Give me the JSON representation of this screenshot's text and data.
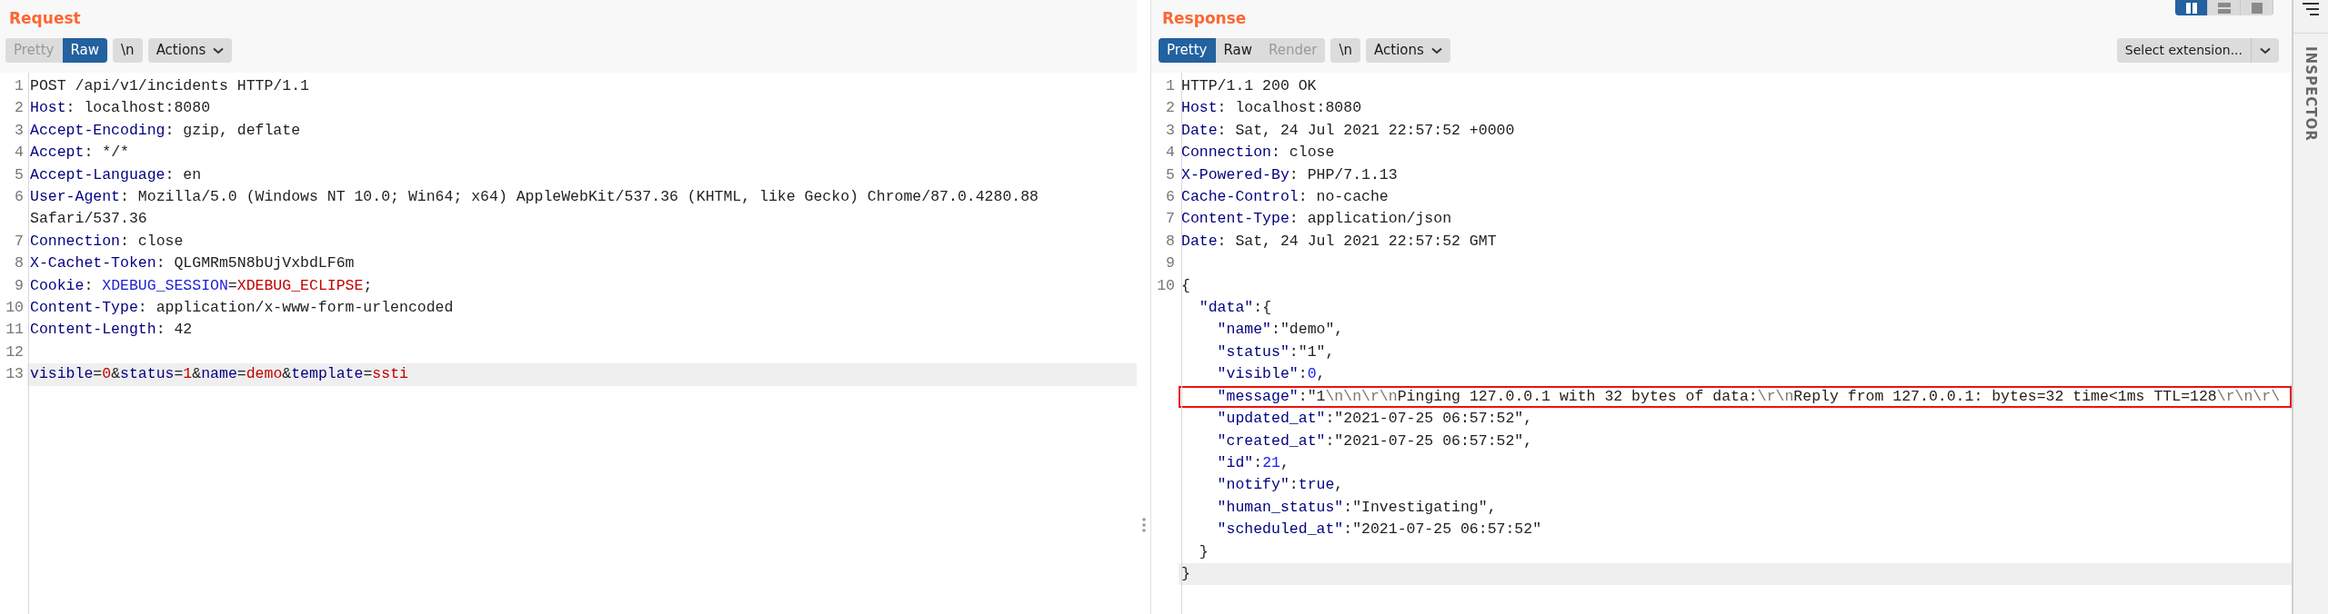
{
  "layout_buttons": [
    {
      "kind": "columns",
      "selected": true
    },
    {
      "kind": "rows",
      "selected": false
    },
    {
      "kind": "single",
      "selected": false
    }
  ],
  "request": {
    "title": "Request",
    "view_tabs": [
      {
        "label": "Pretty",
        "selected": false,
        "disabled": true
      },
      {
        "label": "Raw",
        "selected": true,
        "disabled": false
      }
    ],
    "newline_button": "\\n",
    "actions_button": "Actions",
    "lines": [
      {
        "number": "1",
        "tokens": [
          {
            "kind": "plain",
            "text": "POST /api/v1/incidents HTTP/1.1"
          }
        ]
      },
      {
        "number": "2",
        "tokens": [
          {
            "kind": "key",
            "text": "Host"
          },
          {
            "kind": "plain",
            "text": ": localhost:8080"
          }
        ]
      },
      {
        "number": "3",
        "tokens": [
          {
            "kind": "key",
            "text": "Accept-Encoding"
          },
          {
            "kind": "plain",
            "text": ": gzip, deflate"
          }
        ]
      },
      {
        "number": "4",
        "tokens": [
          {
            "kind": "key",
            "text": "Accept"
          },
          {
            "kind": "plain",
            "text": ": */*"
          }
        ]
      },
      {
        "number": "5",
        "tokens": [
          {
            "kind": "key",
            "text": "Accept-Language"
          },
          {
            "kind": "plain",
            "text": ": en"
          }
        ]
      },
      {
        "number": "6",
        "tokens": [
          {
            "kind": "key",
            "text": "User-Agent"
          },
          {
            "kind": "plain",
            "text": ": Mozilla/5.0 (Windows NT 10.0; Win64; x64) AppleWebKit/537.36 (KHTML, like Gecko) Chrome/87.0.4280.88 Safari/537.36"
          }
        ]
      },
      {
        "number": "7",
        "tokens": [
          {
            "kind": "key",
            "text": "Connection"
          },
          {
            "kind": "plain",
            "text": ": close"
          }
        ]
      },
      {
        "number": "8",
        "tokens": [
          {
            "kind": "key",
            "text": "X-Cachet-Token"
          },
          {
            "kind": "plain",
            "text": ": QLGMRm5N8bUjVxbdLF6m"
          }
        ]
      },
      {
        "number": "9",
        "tokens": [
          {
            "kind": "key",
            "text": "Cookie"
          },
          {
            "kind": "plain",
            "text": ": "
          },
          {
            "kind": "name",
            "text": "XDEBUG_SESSION"
          },
          {
            "kind": "plain",
            "text": "="
          },
          {
            "kind": "value",
            "text": "XDEBUG_ECLIPSE"
          },
          {
            "kind": "plain",
            "text": ";"
          }
        ]
      },
      {
        "number": "10",
        "tokens": [
          {
            "kind": "key",
            "text": "Content-Type"
          },
          {
            "kind": "plain",
            "text": ": application/x-www-form-urlencoded"
          }
        ]
      },
      {
        "number": "11",
        "tokens": [
          {
            "kind": "key",
            "text": "Content-Length"
          },
          {
            "kind": "plain",
            "text": ": 42"
          }
        ]
      },
      {
        "number": "12"
      },
      {
        "number": "13",
        "current": true,
        "tokens": [
          {
            "kind": "key",
            "text": "visible"
          },
          {
            "kind": "plain",
            "text": "="
          },
          {
            "kind": "value",
            "text": "0"
          },
          {
            "kind": "plain",
            "text": "&"
          },
          {
            "kind": "key",
            "text": "status"
          },
          {
            "kind": "plain",
            "text": "="
          },
          {
            "kind": "value",
            "text": "1"
          },
          {
            "kind": "plain",
            "text": "&"
          },
          {
            "kind": "key",
            "text": "name"
          },
          {
            "kind": "plain",
            "text": "="
          },
          {
            "kind": "value",
            "text": "demo"
          },
          {
            "kind": "plain",
            "text": "&"
          },
          {
            "kind": "key",
            "text": "template"
          },
          {
            "kind": "plain",
            "text": "="
          },
          {
            "kind": "value",
            "text": "ssti"
          }
        ]
      }
    ]
  },
  "response": {
    "title": "Response",
    "view_tabs": [
      {
        "label": "Pretty",
        "selected": true,
        "disabled": false
      },
      {
        "label": "Raw",
        "selected": false,
        "disabled": false
      },
      {
        "label": "Render",
        "selected": false,
        "disabled": true
      }
    ],
    "newline_button": "\\n",
    "actions_button": "Actions",
    "extension_select": "Select extension...",
    "lines": [
      {
        "number": "1",
        "tokens": [
          {
            "kind": "plain",
            "text": "HTTP/1.1 200 OK"
          }
        ]
      },
      {
        "number": "2",
        "tokens": [
          {
            "kind": "key",
            "text": "Host"
          },
          {
            "kind": "plain",
            "text": ": localhost:8080"
          }
        ]
      },
      {
        "number": "3",
        "tokens": [
          {
            "kind": "key",
            "text": "Date"
          },
          {
            "kind": "plain",
            "text": ": Sat, 24 Jul 2021 22:57:52 +0000"
          }
        ]
      },
      {
        "number": "4",
        "tokens": [
          {
            "kind": "key",
            "text": "Connection"
          },
          {
            "kind": "plain",
            "text": ": close"
          }
        ]
      },
      {
        "number": "5",
        "tokens": [
          {
            "kind": "key",
            "text": "X-Powered-By"
          },
          {
            "kind": "plain",
            "text": ": PHP/7.1.13"
          }
        ]
      },
      {
        "number": "6",
        "tokens": [
          {
            "kind": "key",
            "text": "Cache-Control"
          },
          {
            "kind": "plain",
            "text": ": no-cache"
          }
        ]
      },
      {
        "number": "7",
        "tokens": [
          {
            "kind": "key",
            "text": "Content-Type"
          },
          {
            "kind": "plain",
            "text": ": application/json"
          }
        ]
      },
      {
        "number": "8",
        "tokens": [
          {
            "kind": "key",
            "text": "Date"
          },
          {
            "kind": "plain",
            "text": ": Sat, 24 Jul 2021 22:57:52 GMT"
          }
        ]
      },
      {
        "number": "9"
      },
      {
        "number": "10",
        "tokens": [
          {
            "kind": "plain",
            "text": "{"
          }
        ]
      },
      {
        "tokens": [
          {
            "kind": "key",
            "text": "  \"data\""
          },
          {
            "kind": "plain",
            "text": ":{"
          }
        ]
      },
      {
        "tokens": [
          {
            "kind": "key",
            "text": "    \"name\""
          },
          {
            "kind": "plain",
            "text": ":\"demo\","
          }
        ]
      },
      {
        "tokens": [
          {
            "kind": "key",
            "text": "    \"status\""
          },
          {
            "kind": "plain",
            "text": ":\"1\","
          }
        ]
      },
      {
        "tokens": [
          {
            "kind": "key",
            "text": "    \"visible\""
          },
          {
            "kind": "plain",
            "text": ":"
          },
          {
            "kind": "number",
            "text": "0"
          },
          {
            "kind": "plain",
            "text": ","
          }
        ]
      },
      {
        "boxed": true,
        "tokens": [
          {
            "kind": "key",
            "text": "    \"message\""
          },
          {
            "kind": "plain",
            "text": ":\"1"
          },
          {
            "kind": "escape",
            "text": "\\n\\n\\r\\n"
          },
          {
            "kind": "plain",
            "text": "Pinging 127.0.0.1 with 32 bytes of data:"
          },
          {
            "kind": "escape",
            "text": "\\r\\n"
          },
          {
            "kind": "plain",
            "text": "Reply from 127.0.0.1: bytes=32 time<1ms TTL=128"
          },
          {
            "kind": "escape",
            "text": "\\r\\n\\r\\"
          }
        ]
      },
      {
        "tokens": [
          {
            "kind": "key",
            "text": "    \"updated_at\""
          },
          {
            "kind": "plain",
            "text": ":\"2021-07-25 06:57:52\","
          }
        ]
      },
      {
        "tokens": [
          {
            "kind": "key",
            "text": "    \"created_at\""
          },
          {
            "kind": "plain",
            "text": ":\"2021-07-25 06:57:52\","
          }
        ]
      },
      {
        "tokens": [
          {
            "kind": "key",
            "text": "    \"id\""
          },
          {
            "kind": "plain",
            "text": ":"
          },
          {
            "kind": "number",
            "text": "21"
          },
          {
            "kind": "plain",
            "text": ","
          }
        ]
      },
      {
        "tokens": [
          {
            "kind": "key",
            "text": "    \"notify\""
          },
          {
            "kind": "plain",
            "text": ":"
          },
          {
            "kind": "literal",
            "text": "true"
          },
          {
            "kind": "plain",
            "text": ","
          }
        ]
      },
      {
        "tokens": [
          {
            "kind": "key",
            "text": "    \"human_status\""
          },
          {
            "kind": "plain",
            "text": ":\"Investigating\","
          }
        ]
      },
      {
        "tokens": [
          {
            "kind": "key",
            "text": "    \"scheduled_at\""
          },
          {
            "kind": "plain",
            "text": ":\"2021-07-25 06:57:52\""
          }
        ]
      },
      {
        "tokens": [
          {
            "kind": "plain",
            "text": "  }"
          }
        ]
      },
      {
        "current": true,
        "tokens": [
          {
            "kind": "plain",
            "text": "}"
          }
        ]
      }
    ]
  },
  "inspector": {
    "label": "INSPECTOR"
  }
}
